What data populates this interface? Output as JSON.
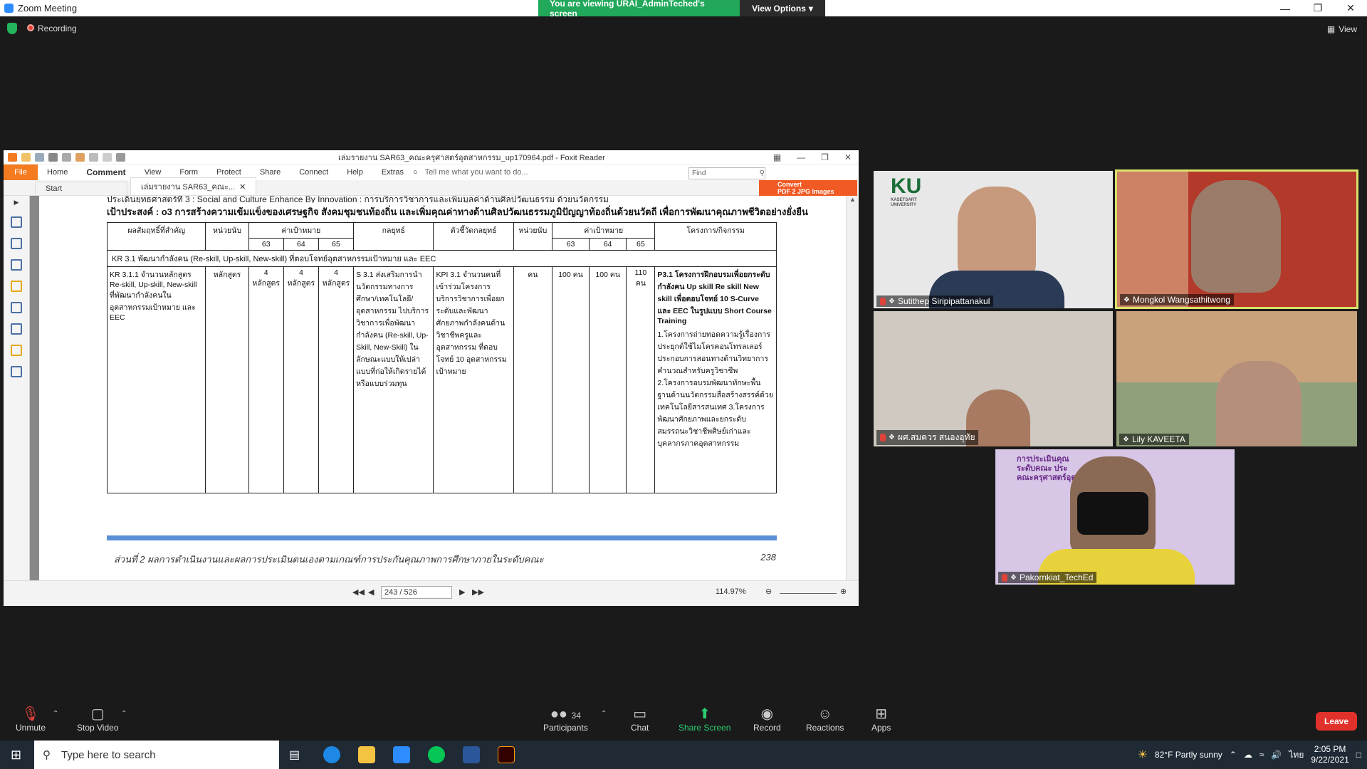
{
  "window": {
    "title": "Zoom Meeting"
  },
  "share_banner": {
    "text": "You are viewing URAI_AdminTeched's screen",
    "view_options": "View Options"
  },
  "status": {
    "recording": "Recording",
    "view": "View"
  },
  "foxit": {
    "title": "เล่มรายงาน SAR63_คณะครุศาสตร์อุตสาหกรรม_up170964.pdf - Foxit Reader",
    "menu": [
      "File",
      "Home",
      "Comment",
      "View",
      "Form",
      "Protect",
      "Share",
      "Connect",
      "Help",
      "Extras"
    ],
    "tell_me": "Tell me what you want to do...",
    "find_placeholder": "Find",
    "tabs": {
      "start": "Start",
      "doc": "เล่มรายงาน SAR63_คณะ..."
    },
    "convert": {
      "line1": "Convert",
      "line2": "PDF 2 JPG Images"
    },
    "page_indicator": "243 / 526",
    "zoom": "114.97%"
  },
  "doc": {
    "heading1": "ประเด็นยุทธศาสตร์ที่ 3 : Social and Culture Enhance By Innovation : การบริการวิชาการและเพิ่มมูลค่าด้านศิลปวัฒนธรรม ด้วยนวัตกรรม",
    "heading2": "เป้าประสงค์ : o3 การสร้างความเข้มแข็งของเศรษฐกิจ สังคมชุมชนท้องถิ่น และเพิ่มคุณค่าทางด้านศิลปวัฒนธรรมภูมิปัญญาท้องถิ่นด้วยนวัตถี เพื่อการพัฒนาคุณภาพชีวิตอย่างยั่งยืน",
    "cols": {
      "result": "ผลสัมฤทธิ์ที่สำคัญ",
      "unit": "หน่วยนับ",
      "target": "ค่าเป้าหมาย",
      "strategy": "กลยุทธ์",
      "kpi": "ตัวชี้วัดกลยุทธ์",
      "unit2": "หน่วยนับ",
      "target2": "ค่าเป้าหมาย",
      "project": "โครงการ/กิจกรรม",
      "y63": "63",
      "y64": "64",
      "y65": "65"
    },
    "kr_row": "KR 3.1 พัฒนากำลังคน (Re-skill, Up-skill, New-skill) ที่ตอบโจทย์อุตสาหกรรมเป้าหมาย และ EEC",
    "row": {
      "result": "KR 3.1.1 จำนวนหลักสูตร Re-skill, Up-skill, New-skill ที่พัฒนากำลังคนในอุตสาหกรรมเป้าหมาย และ EEC",
      "unit": "หลักสูตร",
      "t63": "4 หลักสูตร",
      "t64": "4 หลักสูตร",
      "t65": "4 หลักสูตร",
      "strategy": "S 3.1 ส่งเสริมการนำนวัตกรรมทางการศึกษา/เทคโนโลยี/อุตสาหกรรม ไปบริการวิชาการเพื่อพัฒนากำลังคน (Re-skill, Up-Skill, New-Skill) ในลักษณะแบบให้เปล่าแบบที่ก่อให้เกิดรายได้ หรือแบบร่วมทุน",
      "kpi": "KPI 3.1 จำนวนคนที่เข้าร่วมโครงการบริการวิชาการเพื่อยกระดับและพัฒนาศักยภาพกำลังคนด้านวิชาชีพครูและอุตสาหกรรม ที่ตอบโจทย์ 10 อุตสาหกรรมเป้าหมาย",
      "unit2": "คน",
      "k63": "100 คน",
      "k64": "100 คน",
      "k65": "110 คน",
      "project_title": "P3.1 โครงการฝึกอบรมเพื่อยกระดับกำลังคน Up skill Re skill New skill เพื่อตอบโจทย์ 10 S-Curve และ EEC ในรูปแบบ Short Course Training",
      "project_items": "1.โครงการถ่ายทอดความรู้เรื่องการประยุกต์ใช้ไมโครคอนโทรลเลอร์ประกอบการสอนทางด้านวิทยาการคำนวณสำหรับครูวิชาชีพ 2.โครงการอบรมพัฒนาทักษะพื้นฐานด้านนวัตกรรมสื่อสร้างสรรค์ด้วยเทคโนโลยีสารสนเทศ 3.โครงการพัฒนาศักยภาพและยกระดับสมรรถนะวิชาชีพศิษย์เก่าและบุคลากรภาคอุตสาหกรรม"
    },
    "footer_text": "ส่วนที่ 2 ผลการดำเนินงานและผลการประเมินตนเองตามเกณฑ์การประกันคุณภาพการศึกษาภายในระดับคณะ",
    "page_no": "238"
  },
  "participants": [
    {
      "name": "Sutithep Siripipattanakul",
      "muted": true
    },
    {
      "name": "Mongkol Wangsathitwong",
      "muted": false
    },
    {
      "name": "ผศ.สมควร สนองอุทัย",
      "muted": true
    },
    {
      "name": "Lily KAVEETA",
      "muted": false
    },
    {
      "name": "Pakornkiat_TechEd",
      "muted": true
    }
  ],
  "ku_logo": {
    "big": "KU",
    "line1": "KASETSART",
    "line2": "UNIVERSITY"
  },
  "tile5_banner": {
    "line1": "การประเมินคุณ",
    "line2": "ระดับคณะ ประ",
    "line3": "คณะครุศาสตร์อุต"
  },
  "toolbar": {
    "unmute": "Unmute",
    "stop_video": "Stop Video",
    "participants": "Participants",
    "participants_count": "34",
    "chat": "Chat",
    "share_screen": "Share Screen",
    "record": "Record",
    "reactions": "Reactions",
    "apps": "Apps",
    "leave": "Leave"
  },
  "taskbar": {
    "search_placeholder": "Type here to search",
    "weather": "82°F  Partly sunny",
    "lang": "ไทย",
    "time": "2:05 PM",
    "date": "9/22/2021"
  },
  "colors": {
    "share_green": "#21a85a",
    "leave_red": "#e0322b",
    "foxit_orange": "#f47b20",
    "active_speaker": "#d9e26a"
  }
}
